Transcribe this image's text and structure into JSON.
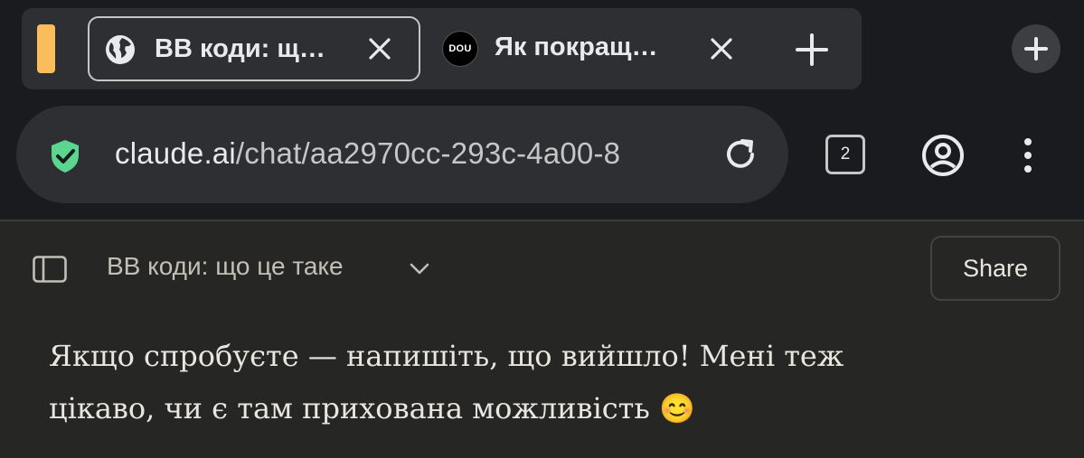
{
  "browser": {
    "tabs": [
      {
        "title": "BB коди: щ…",
        "favicon": "globe-icon",
        "active": true
      },
      {
        "title": "Як покращ…",
        "favicon": "dou-logo",
        "favicon_text": "DOU",
        "active": false
      }
    ],
    "tab_group_color": "#fbbd5b",
    "address_bar": {
      "domain": "claude.ai",
      "path": "/chat/aa2970cc-293c-4a00-8",
      "security_icon": "shield-check-icon",
      "security_color": "#5bd68f"
    },
    "tab_count": "2"
  },
  "chat": {
    "title": "BB коди: що це таке",
    "share_label": "Share",
    "message": {
      "line1": "Якщо спробуєте — напишіть, що вийшло! Мені теж",
      "line2": "цікаво, чи є там прихована можливість 😊"
    }
  }
}
